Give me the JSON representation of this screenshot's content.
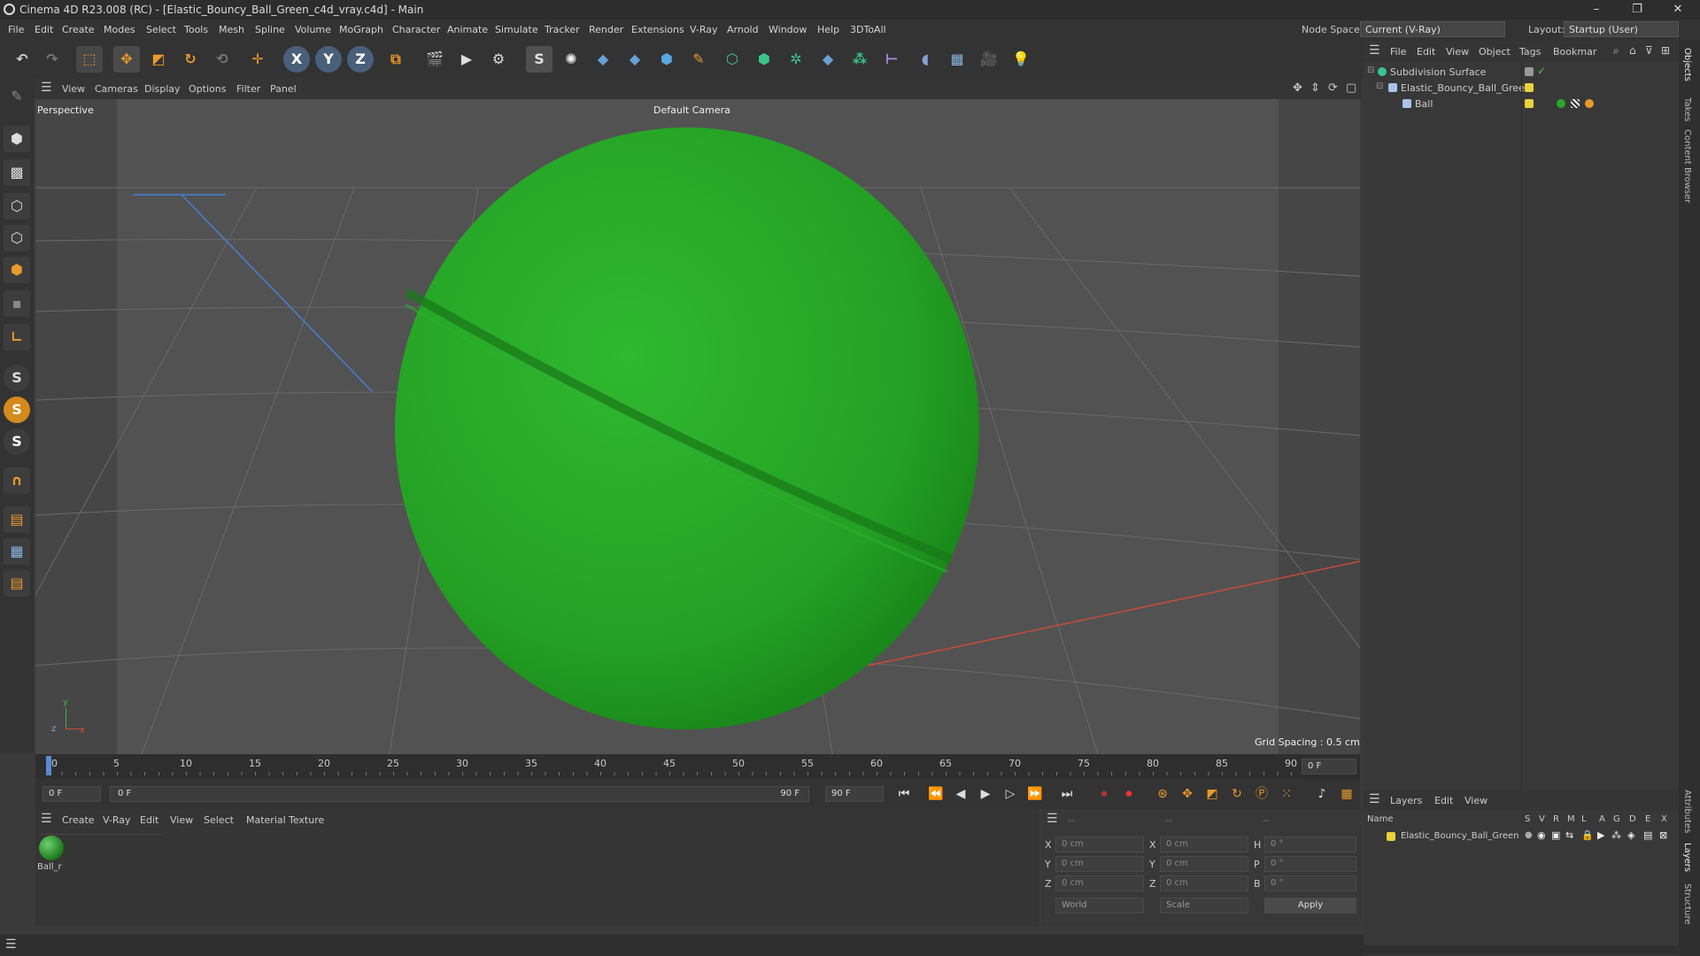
{
  "window": {
    "title": "Cinema 4D R23.008 (RC) - [Elastic_Bouncy_Ball_Green_c4d_vray.c4d] - Main",
    "controls": [
      "–",
      "❐",
      "✕"
    ]
  },
  "menubar": {
    "items": [
      "File",
      "Edit",
      "Create",
      "Modes",
      "Select",
      "Tools",
      "Mesh",
      "Spline",
      "Volume",
      "MoGraph",
      "Character",
      "Animate",
      "Simulate",
      "Tracker",
      "Render",
      "Extensions",
      "V-Ray",
      "Arnold",
      "Window",
      "Help",
      "3DToAll"
    ],
    "node_space_label": "Node Space:",
    "node_space_value": "Current (V-Ray)",
    "layout_label": "Layout:",
    "layout_value": "Startup (User)"
  },
  "toolbar": {
    "axis_x": "X",
    "axis_y": "Y",
    "axis_z": "Z"
  },
  "viewport": {
    "menu": [
      "View",
      "Cameras",
      "Display",
      "Options",
      "Filter",
      "Panel"
    ],
    "label": "Perspective",
    "camera": "Default Camera",
    "grid_spacing": "Grid Spacing : 0.5 cm",
    "ball_color": "#2aa82a",
    "axis_labels": {
      "y": "y",
      "z": "z",
      "x": "x"
    }
  },
  "timeline": {
    "ticks": [
      "0",
      "5",
      "10",
      "15",
      "20",
      "25",
      "30",
      "35",
      "40",
      "45",
      "50",
      "55",
      "60",
      "65",
      "70",
      "75",
      "80",
      "85",
      "90"
    ],
    "current_frame": "0 F"
  },
  "anim": {
    "start": "0 F",
    "range_start": "0 F",
    "range_end": "90 F",
    "end": "90 F"
  },
  "material_manager": {
    "menu": [
      "Create",
      "V-Ray",
      "Edit",
      "View",
      "Select",
      "Material",
      "Texture"
    ],
    "material_name": "Ball_r"
  },
  "coordinates": {
    "header": [
      "--",
      "--",
      "--"
    ],
    "rows": [
      {
        "a": "X",
        "av": "0 cm",
        "b": "X",
        "bv": "0 cm",
        "c": "H",
        "cv": "0 °"
      },
      {
        "a": "Y",
        "av": "0 cm",
        "b": "Y",
        "bv": "0 cm",
        "c": "P",
        "cv": "0 °"
      },
      {
        "a": "Z",
        "av": "0 cm",
        "b": "Z",
        "bv": "0 cm",
        "c": "B",
        "cv": "0 °"
      }
    ],
    "mode": "World",
    "scale": "Scale",
    "apply": "Apply"
  },
  "object_manager": {
    "menu": [
      "File",
      "Edit",
      "View",
      "Object",
      "Tags",
      "Bookmar"
    ],
    "objects": [
      {
        "name": "Subdivision Surface"
      },
      {
        "name": "Elastic_Bouncy_Ball_Green"
      },
      {
        "name": "Ball"
      }
    ]
  },
  "layers": {
    "menu": [
      "Layers",
      "Edit",
      "View"
    ],
    "header_name": "Name",
    "cols": [
      "S",
      "V",
      "R",
      "M",
      "L",
      "A",
      "G",
      "D",
      "E",
      "X"
    ],
    "row_name": "Elastic_Bouncy_Ball_Green",
    "layer_color": "#e8d23c"
  },
  "right_tabs": [
    "Objects",
    "Takes",
    "Content Browser",
    "Attributes",
    "Layers",
    "Structure"
  ]
}
